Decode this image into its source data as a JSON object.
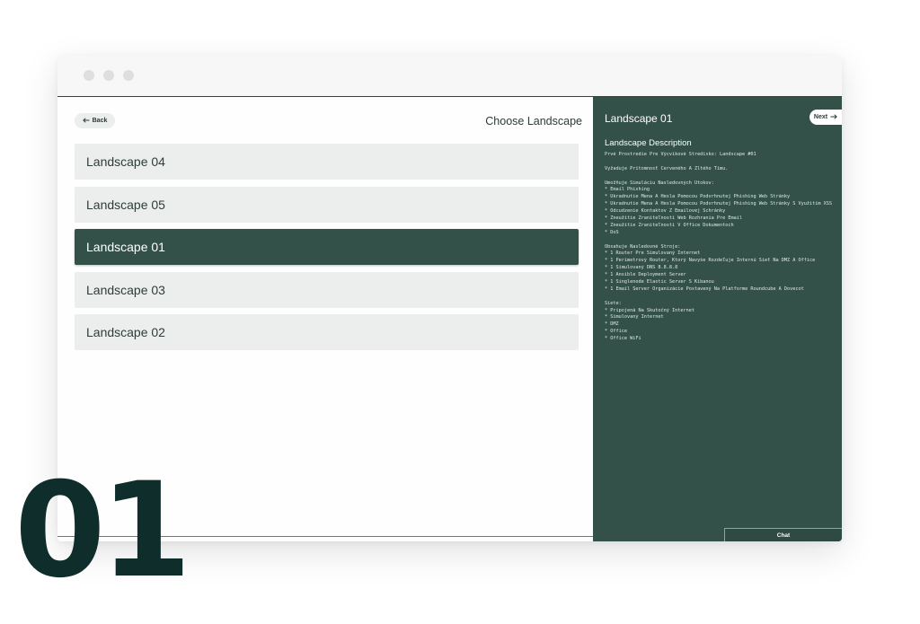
{
  "window": {
    "traffic_lights": [
      "close",
      "minimize",
      "maximize"
    ]
  },
  "toolbar": {
    "back_label": "Back",
    "back_icon": "arrow-left-icon",
    "title": "Choose Landscape"
  },
  "landscapes": [
    {
      "label": "Landscape 04",
      "selected": false
    },
    {
      "label": "Landscape 05",
      "selected": false
    },
    {
      "label": "Landscape 01",
      "selected": true
    },
    {
      "label": "Landscape 03",
      "selected": false
    },
    {
      "label": "Landscape 02",
      "selected": false
    }
  ],
  "detail": {
    "title": "Landscape 01",
    "next_label": "Next",
    "next_icon": "arrow-right-icon",
    "description_heading": "Landscape Description",
    "description_lines": [
      "Prvé Prostredie Pre Výcvikové Stredisko: Landscape #01",
      "",
      "Vyžaduje Prítomnosť Červeného A Žltého Tímu.",
      "",
      "Umožňuje Simuláciu Nasledovných Útokov:",
      "* Email Phishing",
      "* Ukradnutie Mena A Hesla Pomocou Podvrhnutej Phishing Web Stránky",
      "* Ukradnutie Mena A Hesla Pomocou Podvrhnutej Phishing Web Stránky S Využitím XSS",
      "* Odcudzenie Kontaktov Z Emailovej Schránky",
      "* Zneužitie Zraniteľností Web Rozhrania Pre Email",
      "* Zneužitie Zraniteľností V Office Dokumentoch",
      "* DoS",
      "",
      "Obsahuje Nasledovné Stroje:",
      "* 1 Router Pre Simulovaný Internet",
      "* 1 Perimetrový Router, Ktorý Navyše Rozdeľuje Internú Sieť Na DMZ A Office",
      "* 1 Simulovaný DNS 8.8.8.8",
      "* 1 Ansible Deployment Server",
      "* 1 Singlenode Elastic Server S Kibanou",
      "* 1 Email Server Organizácie Postavený Na Platforme Roundcube A Dovecot",
      "",
      "Siete:",
      "* Pripojená Na Skutočný Internet",
      "* Simulovaný Internet",
      "* DMZ",
      "* Office",
      "* Office WiFi"
    ],
    "chat_label": "Chat"
  },
  "overlay": {
    "step_number": "01"
  },
  "colors": {
    "accent": "#345149",
    "list_item_bg": "#eceeed",
    "step_number": "#0f2e2b"
  }
}
